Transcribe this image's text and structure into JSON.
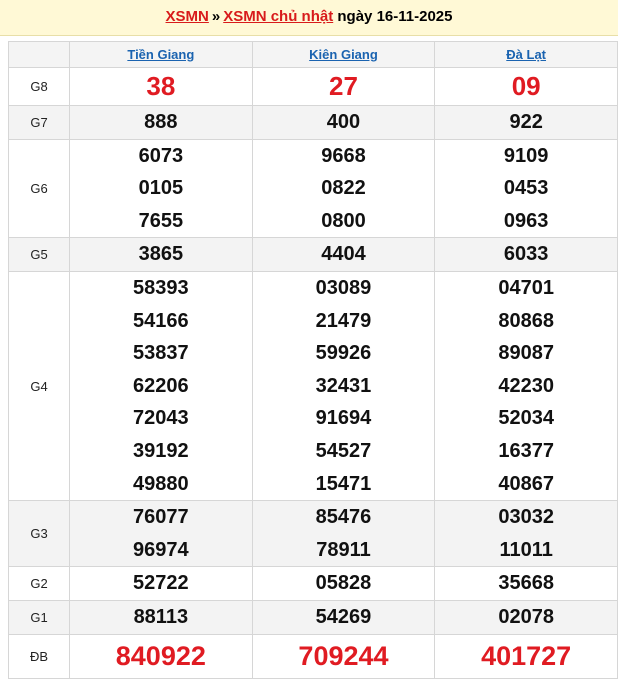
{
  "header": {
    "link1": "XSMN",
    "separator": "»",
    "link2": "XSMN chủ nhật",
    "date_text": "ngày 16-11-2025"
  },
  "provinces": [
    "Tiền Giang",
    "Kiên Giang",
    "Đà Lạt"
  ],
  "prizes": [
    {
      "label": "G8",
      "values": [
        [
          "38"
        ],
        [
          "27"
        ],
        [
          "09"
        ]
      ]
    },
    {
      "label": "G7",
      "values": [
        [
          "888"
        ],
        [
          "400"
        ],
        [
          "922"
        ]
      ]
    },
    {
      "label": "G6",
      "values": [
        [
          "6073",
          "0105",
          "7655"
        ],
        [
          "9668",
          "0822",
          "0800"
        ],
        [
          "9109",
          "0453",
          "0963"
        ]
      ]
    },
    {
      "label": "G5",
      "values": [
        [
          "3865"
        ],
        [
          "4404"
        ],
        [
          "6033"
        ]
      ]
    },
    {
      "label": "G4",
      "values": [
        [
          "58393",
          "54166",
          "53837",
          "62206",
          "72043",
          "39192",
          "49880"
        ],
        [
          "03089",
          "21479",
          "59926",
          "32431",
          "91694",
          "54527",
          "15471"
        ],
        [
          "04701",
          "80868",
          "89087",
          "42230",
          "52034",
          "16377",
          "40867"
        ]
      ]
    },
    {
      "label": "G3",
      "values": [
        [
          "76077",
          "96974"
        ],
        [
          "85476",
          "78911"
        ],
        [
          "03032",
          "11011"
        ]
      ]
    },
    {
      "label": "G2",
      "values": [
        [
          "52722"
        ],
        [
          "05828"
        ],
        [
          "35668"
        ]
      ]
    },
    {
      "label": "G1",
      "values": [
        [
          "88113"
        ],
        [
          "54269"
        ],
        [
          "02078"
        ]
      ]
    },
    {
      "label": "ĐB",
      "values": [
        [
          "840922"
        ],
        [
          "709244"
        ],
        [
          "401727"
        ]
      ]
    }
  ],
  "colors": {
    "accent_red": "#e01b22",
    "link_blue": "#1a63b0",
    "header_bg": "#fff9d6"
  }
}
